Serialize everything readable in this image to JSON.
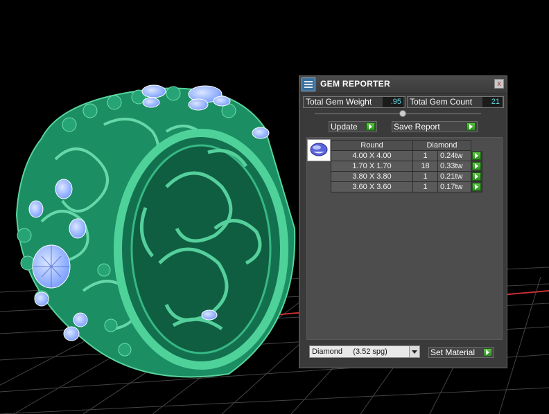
{
  "panel": {
    "title": "GEM REPORTER",
    "close_label": "x",
    "total_weight_label": "Total Gem Weight",
    "total_weight_value": ".95",
    "total_count_label": "Total Gem Count",
    "total_count_value": "21",
    "update_label": "Update",
    "save_report_label": "Save Report",
    "table": {
      "headers": [
        "Round",
        "Diamond"
      ],
      "rows": [
        {
          "size": "4.00 X 4.00",
          "count": "1",
          "tw": "0.24tw"
        },
        {
          "size": "1.70 X 1.70",
          "count": "18",
          "tw": "0.33tw"
        },
        {
          "size": "3.80 X 3.80",
          "count": "1",
          "tw": "0.21tw"
        },
        {
          "size": "3.60 X 3.60",
          "count": "1",
          "tw": "0.17tw"
        }
      ]
    },
    "material_selected": "Diamond     (3.52 spg)",
    "set_material_label": "Set Material"
  },
  "colors": {
    "ring_green": "#1f9a6b",
    "gem_blue": "#8fb4ff",
    "grid_gray": "#5a5a5a",
    "axis_red": "#c83030",
    "accent_green": "#3bb02a",
    "value_cyan": "#5fd7e0"
  },
  "icons": {
    "app": "gem-reporter-icon",
    "close": "close-icon",
    "arrow": "green-arrow-icon",
    "gem": "round-gem-icon",
    "dropdown": "chevron-down-icon"
  }
}
